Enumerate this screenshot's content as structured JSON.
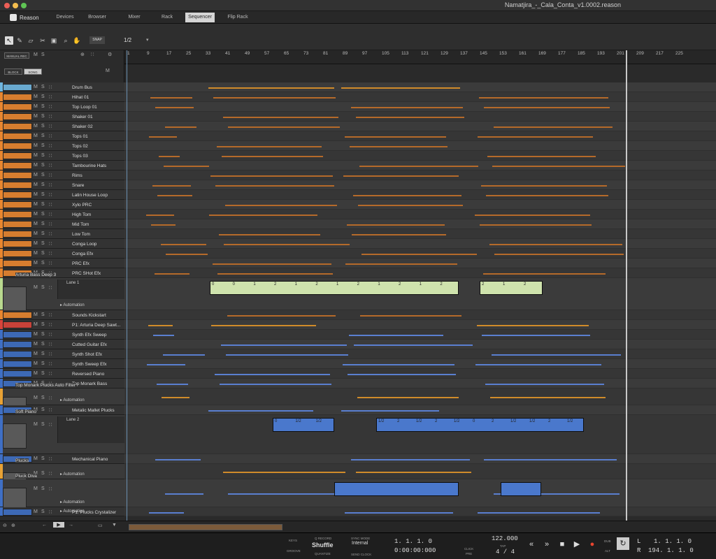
{
  "window": {
    "title": "Namatjira_-_Cala_Conta_v1.0002.reason"
  },
  "app": {
    "name": "Reason"
  },
  "nav": {
    "tabs": [
      "Devices",
      "Browser",
      "Mixer",
      "Rack",
      "Sequencer",
      "Flip Rack"
    ],
    "active": "Sequencer"
  },
  "toolbar": {
    "snap_label": "SNAP",
    "snap_value": "1/2"
  },
  "header": {
    "manual_rec": "MANUAL REC",
    "mute": "M",
    "solo": "S",
    "block": "BLOCK",
    "song": "SONG",
    "master_mute": "M"
  },
  "ruler": {
    "bars": [
      "1",
      "9",
      "17",
      "25",
      "33",
      "41",
      "49",
      "57",
      "65",
      "73",
      "81",
      "89",
      "97",
      "105",
      "113",
      "121",
      "129",
      "137",
      "145",
      "153",
      "161",
      "169",
      "177",
      "185",
      "193",
      "201",
      "209",
      "217",
      "225"
    ]
  },
  "tracks": [
    {
      "name": "Drum Bus",
      "color": "#6fb6e0"
    },
    {
      "name": "Hihat 01",
      "color": "#e8862f"
    },
    {
      "name": "Top Loop 01",
      "color": "#e8862f"
    },
    {
      "name": "Shaker 01",
      "color": "#e8862f"
    },
    {
      "name": "Shaker 02",
      "color": "#e8862f"
    },
    {
      "name": "Tops 01",
      "color": "#e8862f"
    },
    {
      "name": "Tops 02",
      "color": "#e8862f"
    },
    {
      "name": "Tops 03",
      "color": "#e8862f"
    },
    {
      "name": "Tambourine Hats",
      "color": "#e8862f"
    },
    {
      "name": "Rims",
      "color": "#e8862f"
    },
    {
      "name": "Snare",
      "color": "#e8862f"
    },
    {
      "name": "Latin House Loop",
      "color": "#e8862f"
    },
    {
      "name": "Xylo PRC",
      "color": "#e8862f"
    },
    {
      "name": "High Tom",
      "color": "#e8862f"
    },
    {
      "name": "Mid Tom",
      "color": "#e8862f"
    },
    {
      "name": "Low Tom",
      "color": "#e8862f"
    },
    {
      "name": "Conga Loop",
      "color": "#e8862f"
    },
    {
      "name": "Conga Efx",
      "color": "#e8862f"
    },
    {
      "name": "PRC Efx",
      "color": "#e8862f"
    },
    {
      "name": "PRC SHot Efx",
      "color": "#e8862f"
    },
    {
      "name": "Arturia Bass Deep 3",
      "color": "#b9d98f",
      "lane": "Lane 1",
      "automation": "Automation"
    },
    {
      "name": "Sounds Kickstart",
      "color": "#e8862f"
    },
    {
      "name": "P1: Arturia Deep Sawt...",
      "color": "#d9443a"
    },
    {
      "name": "Synth Efx Sweep",
      "color": "#3f6fc4"
    },
    {
      "name": "Cutted Guitar Efx",
      "color": "#3f6fc4"
    },
    {
      "name": "Synth Shot Efx",
      "color": "#3f6fc4"
    },
    {
      "name": "Synth Sweep Efx",
      "color": "#3f6fc4"
    },
    {
      "name": "Reversed Piano",
      "color": "#3f6fc4"
    },
    {
      "name": "Top Monark Bass",
      "color": "#3f6fc4"
    },
    {
      "name": "Top Monark Plucks Auto Filter",
      "color": "#e8a235",
      "automation": "Automation"
    },
    {
      "name": "Metalic Mallet Plucks",
      "color": "#3f6fc4"
    },
    {
      "name": "Soft Piano",
      "color": "#3f6fc4",
      "lane": "Lane 2"
    },
    {
      "name": "Mechanical Piano",
      "color": "#3f6fc4"
    },
    {
      "name": "Plucks",
      "color": "#e8a235",
      "automation": "Automation"
    },
    {
      "name": "Pluck Diva",
      "color": "#3f6fc4",
      "automation": "Automation"
    },
    {
      "name": "P1: Plucks Crystalizer",
      "color": "#3f6fc4",
      "automation": "Automation"
    }
  ],
  "clip_labels": {
    "lane1": [
      "0",
      "0",
      "1",
      "2",
      "1",
      "2",
      "1",
      "2",
      "1",
      "2",
      "1",
      "2"
    ],
    "lane1b": [
      "2",
      "1",
      "2"
    ],
    "lane2": [
      "0",
      "1/2",
      "1/2"
    ],
    "lane2b": [
      "1/2",
      "2",
      "1/2",
      "2",
      "1/2",
      "0",
      "2",
      "1/2",
      "1/2",
      "2",
      "1/2"
    ]
  },
  "transport": {
    "keys": "KEYS",
    "groove": "GROOVE",
    "q_record": "Q RECORD",
    "shuffle": "Shuffle",
    "quantize": "QUANTIZE",
    "sync_mode_label": "SYNC MODE",
    "sync_mode": "Internal",
    "send_clock": "SEND CLOCK",
    "position": "1. 1. 1.   0",
    "time": "0:00:00:000",
    "click": "CLICK",
    "pre": "PRE",
    "tempo": "122.000",
    "tap": "TAP",
    "signature": "4 / 4",
    "dub": "DUB",
    "alt": "ALT",
    "loop_l_label": "L",
    "loop_l": "1. 1. 1.   0",
    "loop_r_label": "R",
    "loop_r": "194. 1. 1.   0"
  }
}
